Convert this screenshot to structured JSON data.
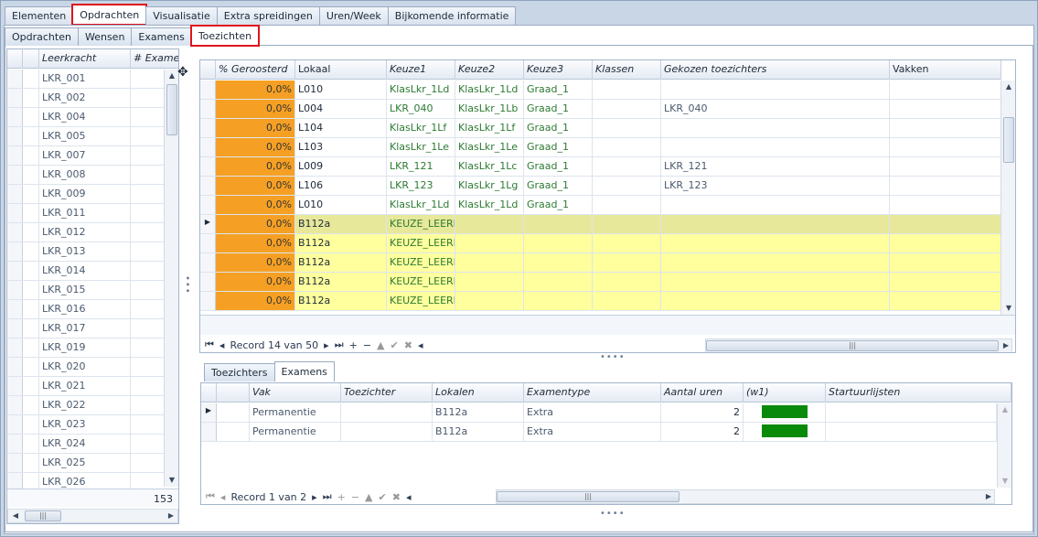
{
  "top_tabs": [
    "Elementen",
    "Opdrachten",
    "Visualisatie",
    "Extra spreidingen",
    "Uren/Week",
    "Bijkomende informatie"
  ],
  "sub_tabs": [
    "Opdrachten",
    "Wensen",
    "Examens",
    "Toezichten"
  ],
  "left_grid": {
    "headers": [
      "Leerkracht",
      "# Examen"
    ],
    "rows": [
      "LKR_001",
      "LKR_002",
      "LKR_004",
      "LKR_005",
      "LKR_007",
      "LKR_008",
      "LKR_009",
      "LKR_011",
      "LKR_012",
      "LKR_013",
      "LKR_014",
      "LKR_015",
      "LKR_016",
      "LKR_017",
      "LKR_019",
      "LKR_020",
      "LKR_021",
      "LKR_022",
      "LKR_023",
      "LKR_024",
      "LKR_025",
      "LKR_026"
    ],
    "total": "153"
  },
  "main_grid": {
    "headers": [
      "% Geroosterd",
      "Lokaal",
      "Keuze1",
      "Keuze2",
      "Keuze3",
      "Klassen",
      "Gekozen toezichters",
      "Vakken"
    ],
    "rows": [
      [
        "0,0%",
        "L010",
        "KlasLkr_1Ld",
        "KlasLkr_1Ld",
        "Graad_1",
        "",
        "",
        ""
      ],
      [
        "0,0%",
        "L004",
        "LKR_040",
        "KlasLkr_1Lb",
        "Graad_1",
        "",
        "LKR_040",
        ""
      ],
      [
        "0,0%",
        "L104",
        "KlasLkr_1Lf",
        "KlasLkr_1Lf",
        "Graad_1",
        "",
        "",
        ""
      ],
      [
        "0,0%",
        "L103",
        "KlasLkr_1Le",
        "KlasLkr_1Le",
        "Graad_1",
        "",
        "",
        ""
      ],
      [
        "0,0%",
        "L009",
        "LKR_121",
        "KlasLkr_1Lc",
        "Graad_1",
        "",
        "LKR_121",
        ""
      ],
      [
        "0,0%",
        "L106",
        "LKR_123",
        "KlasLkr_1Lg",
        "Graad_1",
        "",
        "LKR_123",
        ""
      ],
      [
        "0,0%",
        "L010",
        "KlasLkr_1Ld",
        "KlasLkr_1Ld",
        "Graad_1",
        "",
        "",
        ""
      ],
      [
        "0,0%",
        "B112a",
        "KEUZE_LEERK",
        "",
        "",
        "",
        "",
        ""
      ],
      [
        "0,0%",
        "B112a",
        "KEUZE_LEERK",
        "",
        "",
        "",
        "",
        ""
      ],
      [
        "0,0%",
        "B112a",
        "KEUZE_LEERK",
        "",
        "",
        "",
        "",
        ""
      ],
      [
        "0,0%",
        "B112a",
        "KEUZE_LEERK",
        "",
        "",
        "",
        "",
        ""
      ],
      [
        "0,0%",
        "B112a",
        "KEUZE_LEERK",
        "",
        "",
        "",
        "",
        ""
      ]
    ],
    "record": "Record 14 van 50"
  },
  "bottom_tabs": [
    "Toezichters",
    "Examens"
  ],
  "bottom_grid": {
    "headers": [
      "Vak",
      "Toezichter",
      "Lokalen",
      "Examentype",
      "Aantal uren",
      "(w1)",
      "Startuurlijsten"
    ],
    "rows": [
      [
        "Permanentie",
        "",
        "B112a",
        "Extra",
        "2"
      ],
      [
        "Permanentie",
        "",
        "B112a",
        "Extra",
        "2"
      ]
    ],
    "record": "Record 1 van 2"
  },
  "colors": {
    "highlight": "#e0141b",
    "orange": "#f5a024",
    "yellow": "#ffff9e",
    "green": "#0a8a0a"
  }
}
